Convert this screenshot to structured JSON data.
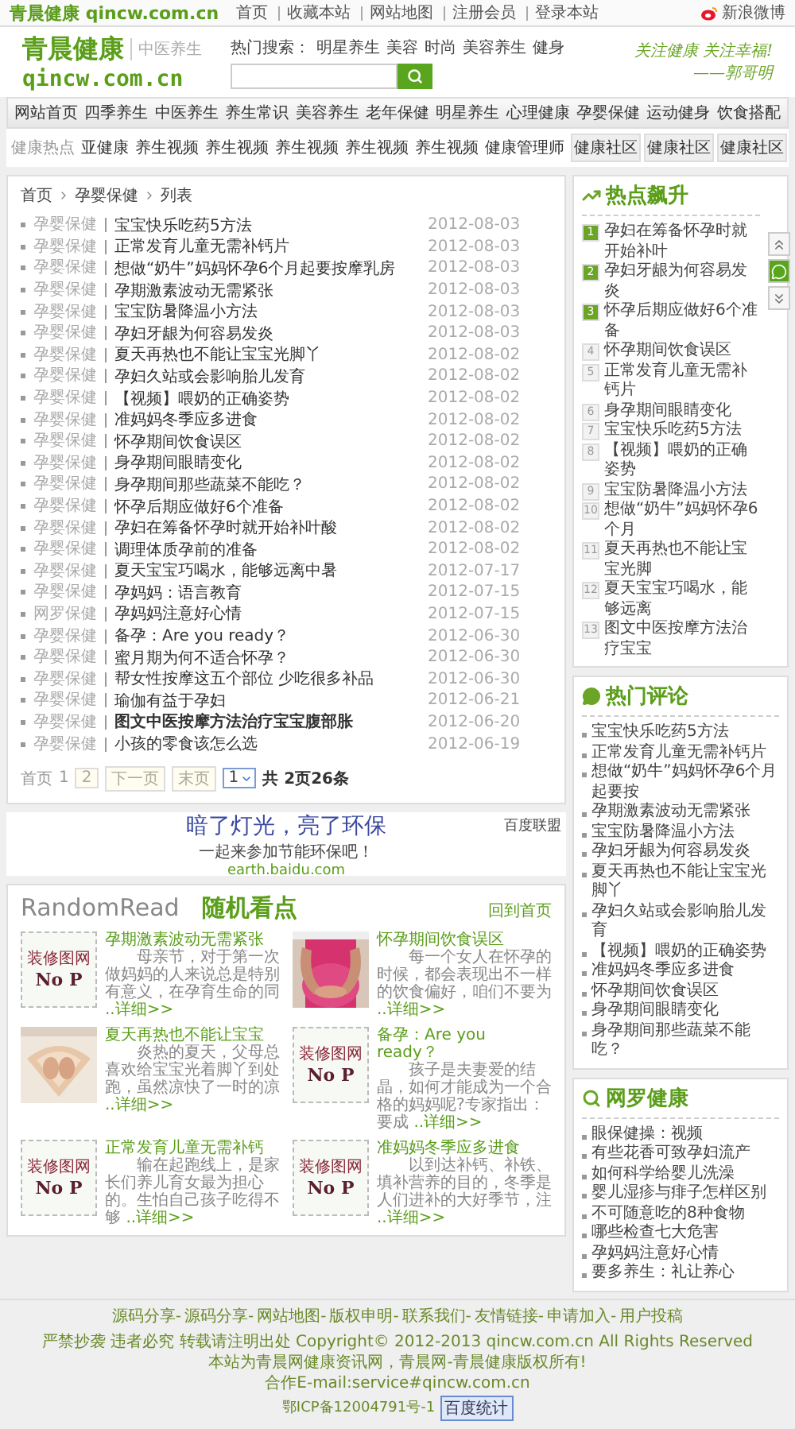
{
  "topbar": {
    "logo_cn": "青晨健康",
    "logo_en": "qincw.com.cn",
    "links": [
      "首页",
      "收藏本站",
      "网站地图",
      "注册会员",
      "登录本站"
    ],
    "weibo": "新浪微博"
  },
  "header": {
    "logo_cn": "青晨健康",
    "logo_sub": "中医养生",
    "logo_en": "qincw.com.cn",
    "hot_label": "热门搜索：",
    "hot_words": [
      "明星养生",
      "美容",
      "时尚",
      "美容养生",
      "健身"
    ],
    "slogan": "关注健康 关注幸福!",
    "signature": "——郭哥明"
  },
  "nav": [
    "网站首页",
    "四季养生",
    "中医养生",
    "养生常识",
    "美容养生",
    "老年保健",
    "明星养生",
    "心理健康",
    "孕婴保健",
    "运动健身",
    "饮食搭配"
  ],
  "subnav": {
    "label": "健康热点",
    "links": [
      "亚健康",
      "养生视频",
      "养生视频",
      "养生视频",
      "养生视频",
      "养生视频",
      "健康管理师"
    ],
    "buttons": [
      "健康社区",
      "健康社区",
      "健康社区"
    ]
  },
  "breadcrumb": [
    "首页",
    "孕婴保健",
    "列表"
  ],
  "articles": [
    {
      "category": "孕婴保健",
      "title": "宝宝快乐吃药5方法",
      "date": "2012-08-03",
      "bold": false
    },
    {
      "category": "孕婴保健",
      "title": "正常发育儿童无需补钙片",
      "date": "2012-08-03",
      "bold": false
    },
    {
      "category": "孕婴保健",
      "title": "想做“奶牛”妈妈怀孕6个月起要按摩乳房",
      "date": "2012-08-03",
      "bold": false
    },
    {
      "category": "孕婴保健",
      "title": "孕期激素波动无需紧张",
      "date": "2012-08-03",
      "bold": false
    },
    {
      "category": "孕婴保健",
      "title": "宝宝防暑降温小方法",
      "date": "2012-08-03",
      "bold": false
    },
    {
      "category": "孕婴保健",
      "title": "孕妇牙龈为何容易发炎",
      "date": "2012-08-03",
      "bold": false
    },
    {
      "category": "孕婴保健",
      "title": "夏天再热也不能让宝宝光脚丫",
      "date": "2012-08-02",
      "bold": false
    },
    {
      "category": "孕婴保健",
      "title": "孕妇久站或会影响胎儿发育",
      "date": "2012-08-02",
      "bold": false
    },
    {
      "category": "孕婴保健",
      "title": "【视频】喂奶的正确姿势",
      "date": "2012-08-02",
      "bold": false
    },
    {
      "category": "孕婴保健",
      "title": "准妈妈冬季应多进食",
      "date": "2012-08-02",
      "bold": false
    },
    {
      "category": "孕婴保健",
      "title": "怀孕期间饮食误区",
      "date": "2012-08-02",
      "bold": false
    },
    {
      "category": "孕婴保健",
      "title": "身孕期间眼睛变化",
      "date": "2012-08-02",
      "bold": false
    },
    {
      "category": "孕婴保健",
      "title": "身孕期间那些蔬菜不能吃？",
      "date": "2012-08-02",
      "bold": false
    },
    {
      "category": "孕婴保健",
      "title": "怀孕后期应做好6个准备",
      "date": "2012-08-02",
      "bold": false
    },
    {
      "category": "孕婴保健",
      "title": "孕妇在筹备怀孕时就开始补叶酸",
      "date": "2012-08-02",
      "bold": false
    },
    {
      "category": "孕婴保健",
      "title": "调理体质孕前的准备",
      "date": "2012-08-02",
      "bold": false
    },
    {
      "category": "孕婴保健",
      "title": "夏天宝宝巧喝水，能够远离中暑",
      "date": "2012-07-17",
      "bold": false
    },
    {
      "category": "孕婴保健",
      "title": "孕妈妈：语言教育",
      "date": "2012-07-15",
      "bold": false
    },
    {
      "category": "网罗保健",
      "title": "孕妈妈注意好心情",
      "date": "2012-07-15",
      "bold": false
    },
    {
      "category": "孕婴保健",
      "title": "备孕：Are you ready？",
      "date": "2012-06-30",
      "bold": false
    },
    {
      "category": "孕婴保健",
      "title": "蜜月期为何不适合怀孕？",
      "date": "2012-06-30",
      "bold": false
    },
    {
      "category": "孕婴保健",
      "title": "帮女性按摩这五个部位 少吃很多补品",
      "date": "2012-06-30",
      "bold": false
    },
    {
      "category": "孕婴保健",
      "title": "瑜伽有益于孕妇",
      "date": "2012-06-21",
      "bold": false
    },
    {
      "category": "孕婴保健",
      "title": "图文中医按摩方法治疗宝宝腹部胀",
      "date": "2012-06-20",
      "bold": true
    },
    {
      "category": "孕婴保健",
      "title": "小孩的零食该怎么选",
      "date": "2012-06-19",
      "bold": false
    }
  ],
  "pagination": {
    "items": [
      {
        "label": "首页",
        "kind": "text"
      },
      {
        "label": "1",
        "kind": "current"
      },
      {
        "label": "2",
        "kind": "link"
      },
      {
        "label": "下一页",
        "kind": "link"
      },
      {
        "label": "末页",
        "kind": "link"
      }
    ],
    "select": "1",
    "summary": "共 2页26条"
  },
  "ad": {
    "headline": "暗了灯光，亮了环保",
    "line": "一起来参加节能环保吧！",
    "url": "earth.baidu.com",
    "badge": "百度联盟"
  },
  "random": {
    "title_en": "RandomRead",
    "title_cn": "随机看点",
    "more": "回到首页",
    "items": [
      {
        "kind": "placeholder",
        "image_text": [
          "装修图网",
          "No P"
        ],
        "title": "孕期激素波动无需紧张",
        "excerpt": "母亲节，对于第一次做妈妈的人来说总是特别有意义，在孕育生命的同",
        "more": "..详细>>"
      },
      {
        "kind": "picture",
        "title": "怀孕期间饮食误区",
        "excerpt": "每一个女人在怀孕的时候，都会表现出不一样的饮食偏好，咱们不要为",
        "more": "..详细>>"
      },
      {
        "kind": "picture",
        "title": "夏天再热也不能让宝宝",
        "excerpt": "炎热的夏天，父母总喜欢给宝宝光着脚丫到处跑，虽然凉快了一时的凉",
        "more": "..详细>>"
      },
      {
        "kind": "placeholder",
        "image_text": [
          "装修图网",
          "No P"
        ],
        "title": "备孕：Are you ready？",
        "excerpt": "孩子是夫妻爱的结晶，如何才能成为一个合格的妈妈呢?专家指出：要成",
        "more": "..详细>>"
      },
      {
        "kind": "placeholder",
        "image_text": [
          "装修图网",
          "No P"
        ],
        "title": "正常发育儿童无需补钙",
        "excerpt": "输在起跑线上，是家长们养儿育女最为担心的。生怕自己孩子吃得不够",
        "more": "..详细>>"
      },
      {
        "kind": "placeholder",
        "image_text": [
          "装修图网",
          "No P"
        ],
        "title": "准妈妈冬季应多进食",
        "excerpt": "以到达补钙、补铁、填补营养的目的，冬季是人们进补的大好季节，注",
        "more": "..详细>>"
      }
    ]
  },
  "sidebar": [
    {
      "kind": "ranked",
      "title": "热点飙升",
      "items": [
        "孕妇在筹备怀孕时就开始补叶",
        "孕妇牙龈为何容易发炎",
        "怀孕后期应做好6个准备",
        "怀孕期间饮食误区",
        "正常发育儿童无需补钙片",
        "身孕期间眼睛变化",
        "宝宝快乐吃药5方法",
        "【视频】喂奶的正确姿势",
        "宝宝防暑降温小方法",
        "想做“奶牛”妈妈怀孕6个月",
        "夏天再热也不能让宝宝光脚",
        "夏天宝宝巧喝水，能够远离",
        "图文中医按摩方法治疗宝宝"
      ],
      "numbers": [
        "1",
        "2",
        "3",
        "4",
        "5",
        "6",
        "7",
        "8",
        "9",
        "10",
        "11",
        "12",
        "13"
      ]
    },
    {
      "kind": "comments",
      "title": "热门评论",
      "items": [
        "宝宝快乐吃药5方法",
        "正常发育儿童无需补钙片",
        "想做“奶牛”妈妈怀孕6个月起要按",
        "孕期激素波动无需紧张",
        "宝宝防暑降温小方法",
        "孕妇牙龈为何容易发炎",
        "夏天再热也不能让宝宝光脚丫",
        "孕妇久站或会影响胎儿发育",
        "【视频】喂奶的正确姿势",
        "准妈妈冬季应多进食",
        "怀孕期间饮食误区",
        "身孕期间眼睛变化",
        "身孕期间那些蔬菜不能吃？"
      ]
    },
    {
      "kind": "search",
      "title": "网罗健康",
      "items": [
        "眼保健操：视频",
        "有些花香可致孕妇流产",
        "如何科学给婴儿洗澡",
        "婴儿湿疹与痱子怎样区别",
        "不可随意吃的8种食物",
        "哪些检查七大危害",
        "孕妈妈注意好心情",
        "要多养生：礼让养心"
      ]
    }
  ],
  "footer": {
    "links": [
      "源码分享-",
      "源码分享-",
      "网站地图-",
      "版权申明-",
      "联系我们-",
      "友情链接-",
      "申请加入-",
      "用户投稿"
    ],
    "lines": [
      "严禁抄袭 违者必究 转载请注明出处 Copyright© 2012-2013 qincw.com.cn All Rights Reserved",
      "本站为青晨网健康资讯网，青晨网-青晨健康版权所有!",
      "合作E-mail:service#qincw.com.cn"
    ],
    "icp": "鄂ICP备12004791号-1",
    "stats": "百度统计"
  }
}
